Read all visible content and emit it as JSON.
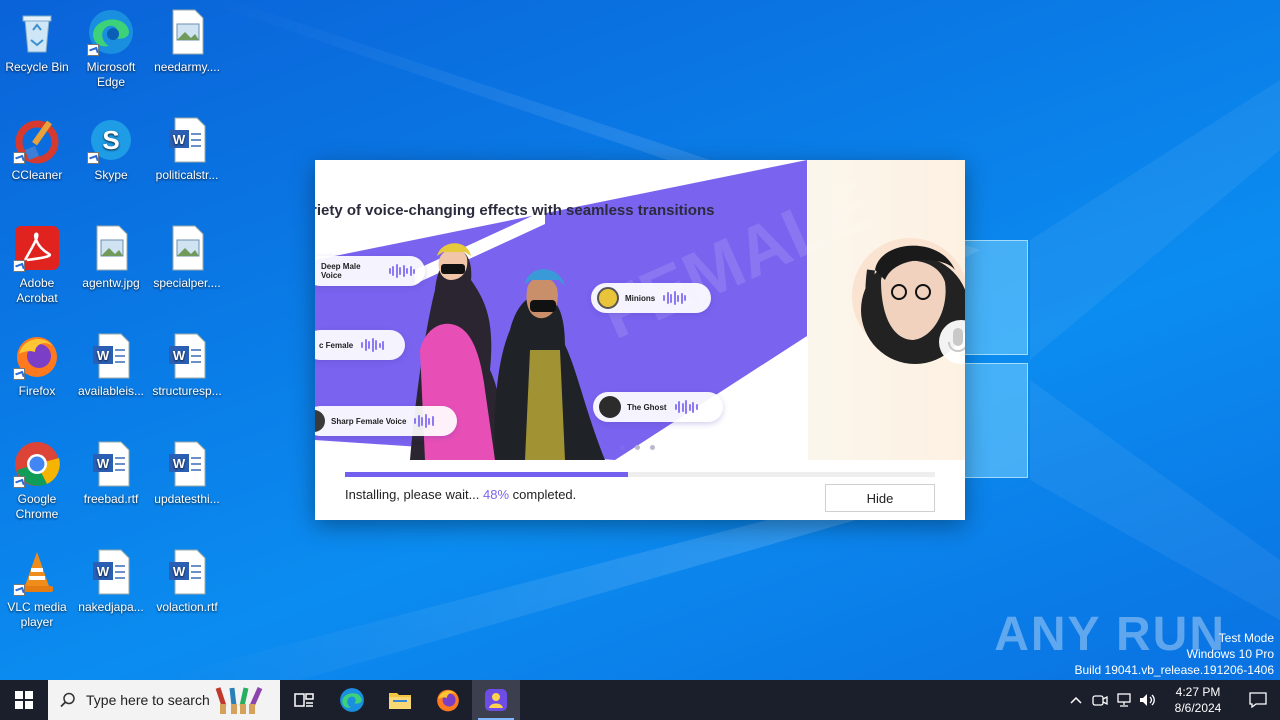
{
  "desktop": {
    "icons": [
      {
        "label": "Recycle Bin"
      },
      {
        "label": "Microsoft Edge"
      },
      {
        "label": "needarmy...."
      },
      {
        "label": "CCleaner"
      },
      {
        "label": "Skype"
      },
      {
        "label": "politicalstr..."
      },
      {
        "label": "Adobe Acrobat"
      },
      {
        "label": "agentw.jpg"
      },
      {
        "label": "specialper...."
      },
      {
        "label": "Firefox"
      },
      {
        "label": "availableis..."
      },
      {
        "label": "structuresp..."
      },
      {
        "label": "Google Chrome"
      },
      {
        "label": "freebad.rtf"
      },
      {
        "label": "updatesthi..."
      },
      {
        "label": "VLC media player"
      },
      {
        "label": "nakedjapa..."
      },
      {
        "label": "volaction.rtf"
      }
    ]
  },
  "installer": {
    "headline": "riety of voice-changing effects with seamless transitions",
    "banner_watermark": "FEMALE",
    "chips": [
      {
        "label": "Deep Male Voice"
      },
      {
        "label": "c Female"
      },
      {
        "label": "Sharp Female Voice"
      },
      {
        "label": "Minions"
      },
      {
        "label": "The Ghost"
      }
    ],
    "progress": 0.48,
    "status_prefix": "Installing, please wait... ",
    "status_percent": "48%",
    "status_suffix": " completed.",
    "hide_label": "Hide",
    "accent_color": "#7460ee"
  },
  "watermark": {
    "brand": "ANY RUN",
    "line1": "Test Mode",
    "line2": "Windows 10 Pro",
    "line3": "Build 19041.vb_release.191206-1406"
  },
  "taskbar": {
    "search_placeholder": "Type here to search",
    "apps": [
      "task-view",
      "edge",
      "file-explorer",
      "firefox",
      "voice-changer-installer"
    ],
    "clock_time": "4:27 PM",
    "clock_date": "8/6/2024"
  }
}
